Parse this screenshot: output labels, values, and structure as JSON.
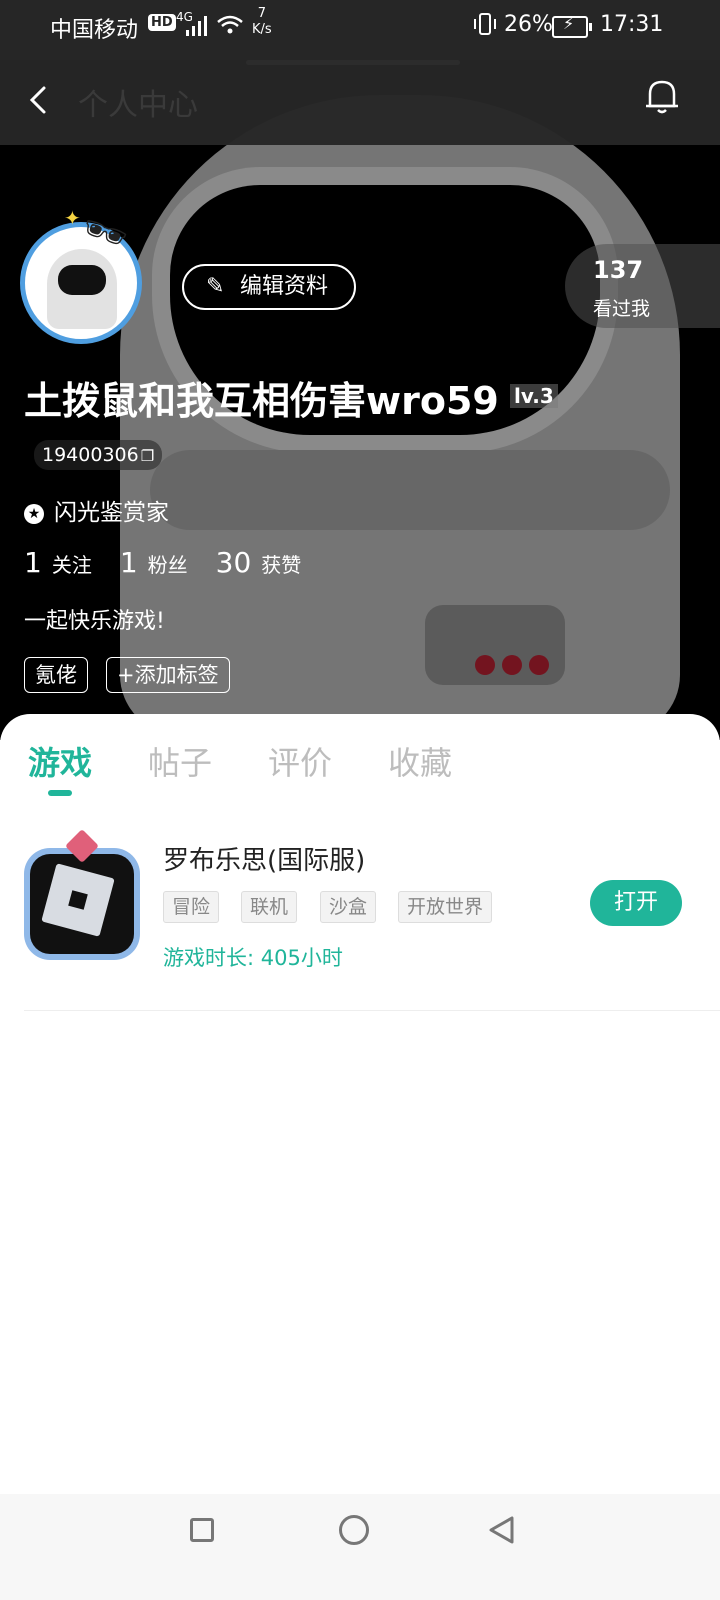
{
  "status_bar": {
    "carrier": "中国移动",
    "hd": "HD",
    "network": "4G",
    "speed_value": "7",
    "speed_unit": "K/s",
    "battery": "26%",
    "time": "17:31"
  },
  "header": {
    "title": "个人中心",
    "icons": [
      "back-icon",
      "bell-icon"
    ]
  },
  "profile": {
    "edit_button": "编辑资料",
    "visitors_count": "137",
    "visitors_label": "看过我",
    "username": "土拨鼠和我互相伤害wro59",
    "level": "lv.3",
    "user_id": "19400306",
    "badge": "闪光鉴赏家",
    "stats": [
      {
        "value": "1",
        "label": "关注"
      },
      {
        "value": "1",
        "label": "粉丝"
      },
      {
        "value": "30",
        "label": "获赞"
      }
    ],
    "bio": "一起快乐游戏!",
    "tags": [
      "氪佬",
      "+添加标签"
    ]
  },
  "tabs": [
    {
      "label": "游戏",
      "active": true
    },
    {
      "label": "帖子",
      "active": false
    },
    {
      "label": "评价",
      "active": false
    },
    {
      "label": "收藏",
      "active": false
    }
  ],
  "games": [
    {
      "name": "罗布乐思(国际服)",
      "tags": [
        "冒险",
        "联机",
        "沙盒",
        "开放世界"
      ],
      "playtime_label": "游戏时长:",
      "playtime_value": "405小时",
      "action": "打开"
    }
  ],
  "colors": {
    "accent": "#20b59a",
    "avatar_ring": "#4f9ee0",
    "header_bg": "#262626"
  }
}
